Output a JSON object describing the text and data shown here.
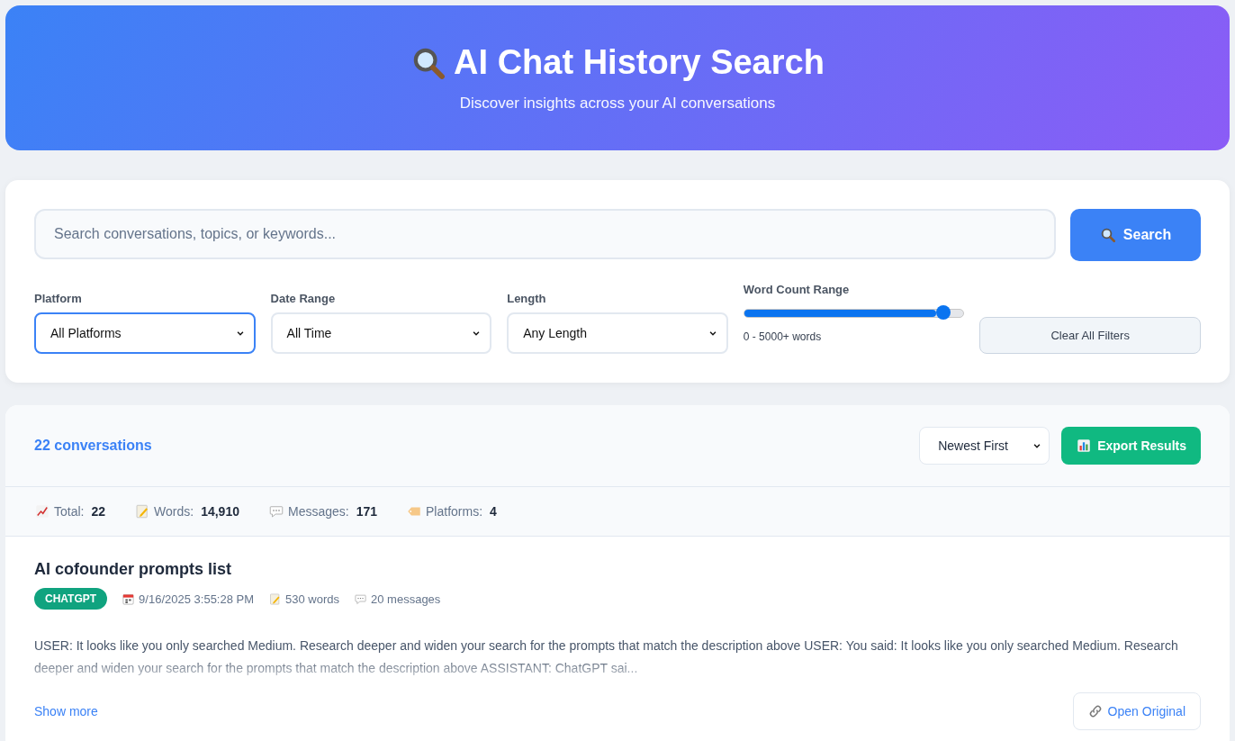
{
  "header": {
    "title": "AI Chat History Search",
    "subtitle": "Discover insights across your AI conversations"
  },
  "search": {
    "placeholder": "Search conversations, topics, or keywords...",
    "button": "Search"
  },
  "filters": [
    {
      "kind": "select",
      "label": "Platform",
      "value": "All Platforms",
      "focused": true
    },
    {
      "kind": "select",
      "label": "Date Range",
      "value": "All Time",
      "focused": false
    },
    {
      "kind": "select",
      "label": "Length",
      "value": "Any Length",
      "focused": false
    },
    {
      "kind": "slider",
      "label": "Word Count Range",
      "level": 0.91,
      "reading": "0 - 5000+ words"
    }
  ],
  "clear_button": "Clear All Filters",
  "results": {
    "count": "22 conversations",
    "sort": "Newest First",
    "export_button": "Export Results"
  },
  "stats": [
    {
      "kind": "total",
      "label": "Total:",
      "value": "22"
    },
    {
      "kind": "words",
      "label": "Words:",
      "value": "14,910"
    },
    {
      "kind": "messages",
      "label": "Messages:",
      "value": "171"
    },
    {
      "kind": "platforms",
      "label": "Platforms:",
      "value": "4"
    }
  ],
  "conversations": [
    {
      "title": "AI cofounder prompts list",
      "platform": "CHATGPT",
      "color": "#10a37f",
      "date": "9/16/2025 3:55:28 PM",
      "words": "530 words",
      "messages": "20 messages",
      "preview": "USER: It looks like you only searched Medium. Research deeper and widen your search for the prompts that match the description above USER: You said: It looks like you only searched Medium. Research deeper and widen your search for the prompts that match the description above ASSISTANT: ChatGPT sai...",
      "show_more": "Show more",
      "open_button": "Open Original"
    }
  ]
}
